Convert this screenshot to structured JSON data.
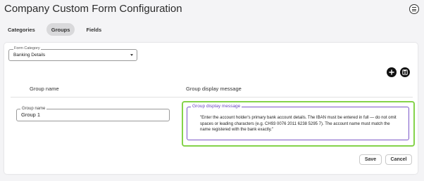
{
  "page": {
    "title": "Company Custom Form Configuration",
    "menu_icon": "hamburger-menu-icon"
  },
  "tabs": [
    {
      "label": "Categories",
      "active": false
    },
    {
      "label": "Groups",
      "active": true
    },
    {
      "label": "Fields",
      "active": false
    }
  ],
  "form_category": {
    "legend": "Form Category",
    "value": "Banking Details"
  },
  "toolbar": {
    "add_icon": "plus-icon",
    "save_icon": "save-disk-icon"
  },
  "table": {
    "columns": [
      "Group name",
      "Group display message"
    ],
    "row": {
      "group_name_legend": "Group name",
      "group_name_value": "Group 1",
      "display_message_legend": "Group display message",
      "display_message_value": "\"Enter the account holder's primary bank account details. The IBAN must be entered in full — do not omit spaces or leading characters (e.g. CH93 0076 2011 6238 5295 7). The account name must match the name registered with the bank exactly.\""
    }
  },
  "actions": {
    "save_label": "Save",
    "cancel_label": "Cancel"
  },
  "colors": {
    "highlight_border": "#84d34a",
    "focus_border": "#7b56c8",
    "active_tab_bg": "#d9d9db"
  }
}
